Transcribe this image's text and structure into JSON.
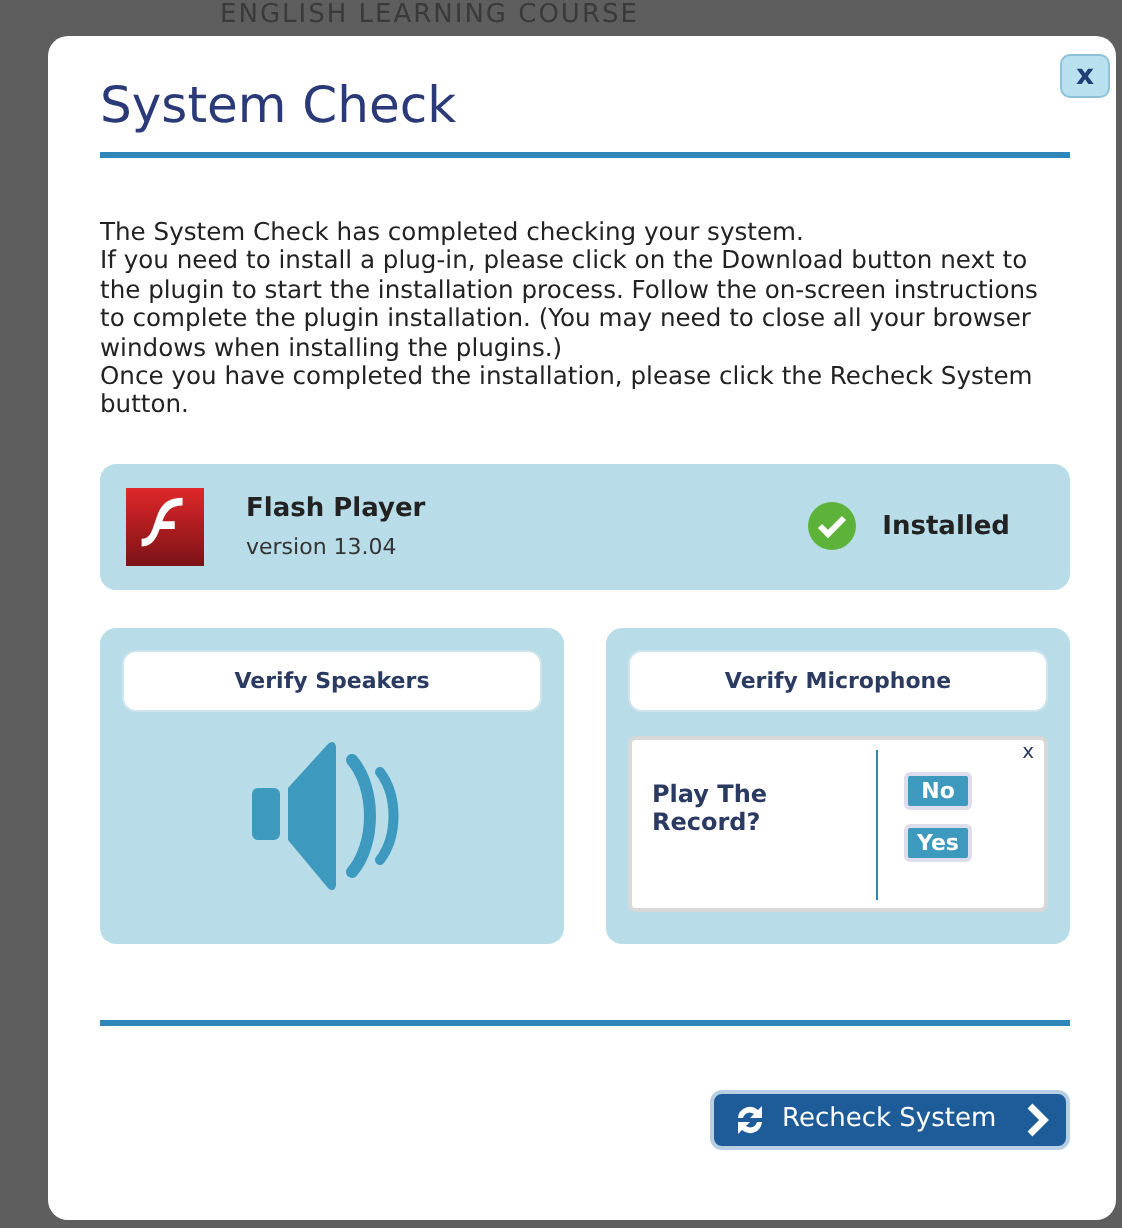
{
  "background": {
    "header": "ENGLISH LEARNING COURSE"
  },
  "dialog": {
    "title": "System Check",
    "close": "x",
    "paragraphs": [
      "The System Check has completed checking your system.",
      "If you need to install a plug-in, please click on the Download button next to the plugin to start the installation process. Follow the on-screen instructions to complete the plugin installation. (You may need to close all your browser windows when installing the plugins.)",
      "Once you have completed the installation, please click the Recheck System button."
    ],
    "plugin": {
      "name": "Flash Player",
      "version": "version 13.04",
      "status": "Installed",
      "installed": true
    },
    "speakers": {
      "button": "Verify Speakers"
    },
    "microphone": {
      "button": "Verify Microphone",
      "prompt": {
        "close": "x",
        "question": "Play The Record?",
        "buttons": [
          "No",
          "Yes"
        ]
      }
    },
    "recheck_button": "Recheck System"
  }
}
